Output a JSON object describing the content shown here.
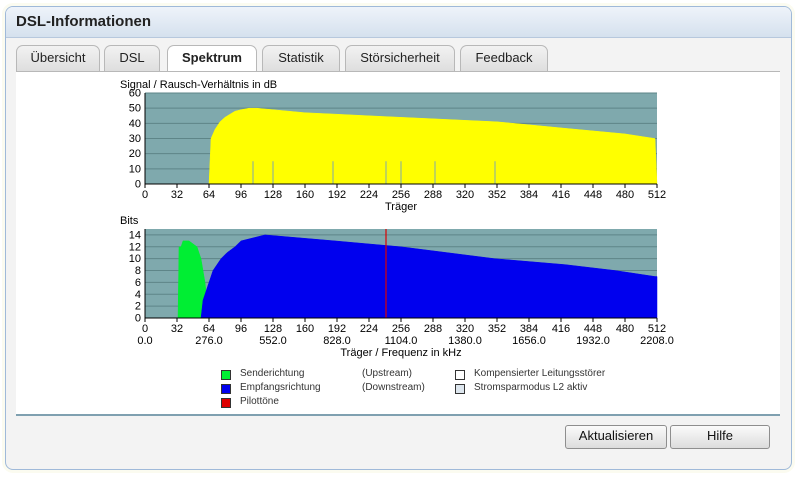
{
  "header": {
    "title": "DSL-Informationen"
  },
  "tabs": [
    {
      "label": "Übersicht",
      "active": false
    },
    {
      "label": "DSL",
      "active": false
    },
    {
      "label": "Spektrum",
      "active": true
    },
    {
      "label": "Statistik",
      "active": false
    },
    {
      "label": "Störsicherheit",
      "active": false
    },
    {
      "label": "Feedback",
      "active": false
    }
  ],
  "colors": {
    "plot_bg": "#7fa9ad",
    "snr_fill": "#ffff00",
    "upstream": "#00ee33",
    "downstream": "#0000ee",
    "pilot": "#dd0000"
  },
  "chart_data": [
    {
      "type": "area",
      "title": "Signal / Rausch-Verhältnis in dB",
      "xlabel": "Träger",
      "ylabel": "",
      "xlim": [
        0,
        512
      ],
      "ylim": [
        0,
        60
      ],
      "xticks": [
        "0",
        "32",
        "64",
        "96",
        "128",
        "160",
        "192",
        "224",
        "256",
        "288",
        "320",
        "352",
        "384",
        "416",
        "448",
        "480",
        "512"
      ],
      "yticks": [
        "0",
        "10",
        "20",
        "30",
        "40",
        "50",
        "60"
      ],
      "grid": true,
      "series": [
        {
          "x": [
            64,
            66,
            70,
            75,
            80,
            85,
            90,
            96,
            104,
            112,
            128,
            160,
            192,
            224,
            256,
            288,
            320,
            352,
            384,
            416,
            448,
            480,
            500,
            510,
            512
          ],
          "y": [
            0,
            30,
            36,
            41,
            44,
            46,
            48,
            49,
            50,
            50,
            49,
            47,
            46,
            45,
            44,
            43,
            42,
            41,
            39,
            37,
            35,
            33,
            31,
            30,
            0
          ]
        }
      ],
      "notches_x": [
        108,
        128,
        188,
        241,
        256,
        290,
        350
      ]
    },
    {
      "type": "area",
      "title": "Bits",
      "xlabel": "Träger / Frequenz in kHz",
      "ylabel": "",
      "xlim": [
        0,
        512
      ],
      "ylim": [
        0,
        15
      ],
      "xticks": [
        "0",
        "32",
        "64",
        "96",
        "128",
        "160",
        "192",
        "224",
        "256",
        "288",
        "320",
        "352",
        "384",
        "416",
        "448",
        "480",
        "512"
      ],
      "xticks_khz": [
        "0.0",
        "276.0",
        "552.0",
        "828.0",
        "1104.0",
        "1380.0",
        "1656.0",
        "1932.0",
        "2208.0"
      ],
      "yticks": [
        "0",
        "2",
        "4",
        "6",
        "8",
        "10",
        "12",
        "14"
      ],
      "grid": true,
      "series": [
        {
          "name": "Senderichtung",
          "x": [
            33,
            34,
            36,
            38,
            44,
            52,
            56,
            60,
            62,
            62
          ],
          "y": [
            0,
            12,
            12,
            13,
            13,
            12,
            10,
            6,
            3,
            0
          ]
        },
        {
          "name": "Empfangsrichtung",
          "x": [
            56,
            58,
            62,
            64,
            68,
            72,
            76,
            82,
            90,
            96,
            120,
            190,
            256,
            350,
            420,
            470,
            510,
            512,
            512
          ],
          "y": [
            0,
            3,
            5,
            6,
            8,
            9,
            10,
            11,
            12,
            13,
            14,
            13,
            12,
            10,
            9,
            8,
            7,
            7,
            0
          ]
        },
        {
          "name": "Pilottöne",
          "x": [
            241
          ],
          "y": [
            15
          ]
        }
      ]
    }
  ],
  "legend": [
    {
      "label": "Senderichtung",
      "dir": "(Upstream)",
      "color": "#00ee33"
    },
    {
      "label": "Empfangsrichtung",
      "dir": "(Downstream)",
      "color": "#0000ee"
    },
    {
      "label": "Pilottöne",
      "dir": "",
      "color": "#dd0000"
    },
    {
      "label": "Kompensierter Leitungsstörer",
      "color": "#ffffff"
    },
    {
      "label": "Stromsparmodus L2 aktiv",
      "color": "#dde6ee"
    }
  ],
  "buttons": {
    "refresh": "Aktualisieren",
    "help": "Hilfe"
  }
}
